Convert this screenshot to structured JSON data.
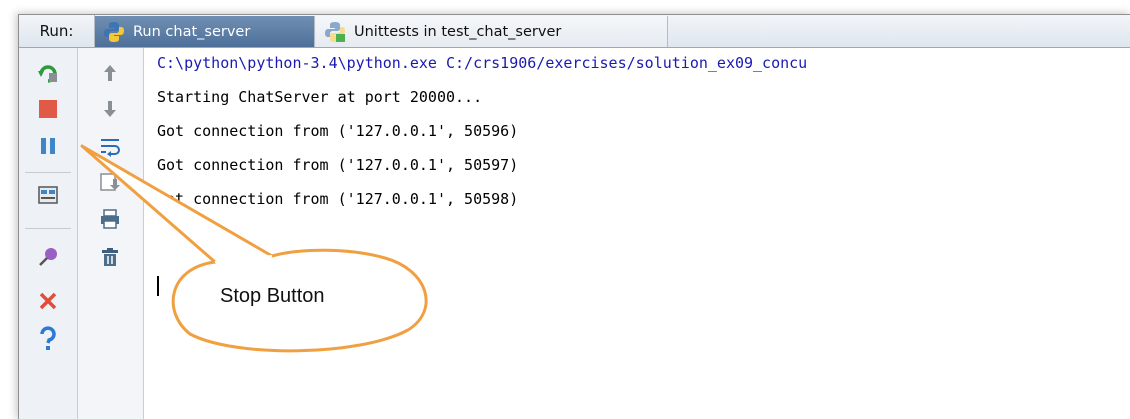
{
  "panel": {
    "run_label": "Run:"
  },
  "tabs": [
    {
      "label": "Run chat_server",
      "active": true
    },
    {
      "label": "Unittests in test_chat_server",
      "active": false
    }
  ],
  "toolbar_left": [
    {
      "icon": "rerun-icon"
    },
    {
      "icon": "stop-icon",
      "color": "#e05a47"
    },
    {
      "icon": "pause-icon"
    },
    {
      "icon": "layout-icon"
    },
    {
      "icon": "pin-icon"
    },
    {
      "icon": "close-icon",
      "color": "#e04e39"
    },
    {
      "icon": "help-icon",
      "color": "#2b7bd6"
    }
  ],
  "toolbar_right": [
    {
      "icon": "up-arrow-icon"
    },
    {
      "icon": "down-arrow-icon"
    },
    {
      "icon": "soft-wrap-icon"
    },
    {
      "icon": "scroll-to-end-icon"
    },
    {
      "icon": "print-icon"
    },
    {
      "icon": "trash-icon"
    }
  ],
  "console": {
    "lines": [
      "C:\\python\\python-3.4\\python.exe C:/crs1906/exercises/solution_ex09_concu",
      "Starting ChatServer at port 20000...",
      "Got connection from ('127.0.0.1', 50596)",
      "Got connection from ('127.0.0.1', 50597)",
      "Got connection from ('127.0.0.1', 50598)"
    ]
  },
  "callout": {
    "text": "Stop Button"
  },
  "colors": {
    "active_tab": "#5a7ba3",
    "callout_border": "#f0a040",
    "command_text": "#1a1ab3"
  }
}
